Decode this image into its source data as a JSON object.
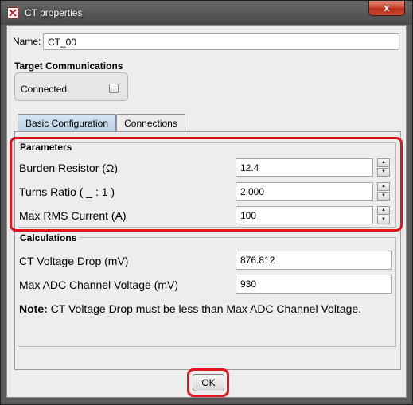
{
  "window": {
    "title": "CT properties",
    "close_glyph": "x"
  },
  "name_field": {
    "label": "Name:",
    "value": "CT_00"
  },
  "target_comms": {
    "heading": "Target Communications",
    "connected_label": "Connected",
    "connected_checked": false
  },
  "tabs": [
    {
      "label": "Basic Configuration",
      "active": true
    },
    {
      "label": "Connections",
      "active": false
    }
  ],
  "parameters": {
    "heading": "Parameters",
    "rows": [
      {
        "label": "Burden Resistor (Ω)",
        "value": "12.4"
      },
      {
        "label": "Turns Ratio ( _ : 1 )",
        "value": "2,000"
      },
      {
        "label": "Max RMS Current (A)",
        "value": "100"
      }
    ]
  },
  "calculations": {
    "heading": "Calculations",
    "rows": [
      {
        "label": "CT Voltage Drop (mV)",
        "value": "876.812"
      },
      {
        "label": "Max ADC Channel Voltage (mV)",
        "value": "930"
      }
    ],
    "note_bold": "Note:",
    "note_text": " CT Voltage Drop must be less than Max ADC Channel Voltage."
  },
  "ok_button": {
    "label": "OK"
  },
  "colors": {
    "highlight": "#e3141b",
    "titlebar": "#5a5a5a",
    "active_tab": "#c6dced"
  }
}
